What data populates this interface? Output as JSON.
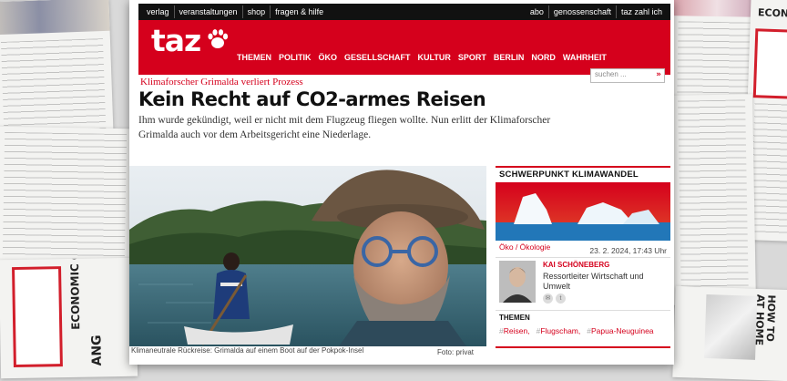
{
  "topbar": {
    "left_links": [
      "verlag",
      "veranstaltungen",
      "shop",
      "fragen & hilfe"
    ],
    "right_links": [
      "abo",
      "genossenschaft",
      "taz zahl ich"
    ]
  },
  "header": {
    "logo_text": "taz",
    "brand_color": "#d5001c",
    "nav": [
      "THEMEN",
      "POLITIK",
      "ÖKO",
      "GESELLSCHAFT",
      "KULTUR",
      "SPORT",
      "BERLIN",
      "NORD",
      "WAHRHEIT"
    ],
    "nav_active": "ÖKO",
    "search_placeholder": "suchen ...",
    "search_icon": "double-chevron-right-icon"
  },
  "article": {
    "kicker": "Klimaforscher Grimalda verliert Prozess",
    "headline": "Kein Recht auf CO2-armes Reisen",
    "teaser": "Ihm wurde gekündigt, weil er nicht mit dem Flugzeug fliegen wollte. Nun erlitt der Klimaforscher Grimalda auch vor dem Arbeitsgericht eine Niederlage.",
    "image_caption": "Klimaneutrale Rückreise: Grimalda auf einem Boot auf der Pokpok-Insel",
    "image_credit": "Foto: privat"
  },
  "sidebar": {
    "focus_title": "SCHWERPUNKT KLIMAWANDEL",
    "category": "Öko / Ökologie",
    "date": "23. 2. 2024, 17:43 Uhr",
    "author_name": "KAI SCHÖNEBERG",
    "author_role": "Ressortleiter Wirtschaft und Umwelt",
    "share_icons": [
      "mail-icon",
      "twitter-icon"
    ],
    "themen_label": "THEMEN",
    "tags": [
      "Reisen",
      "Flugscham",
      "Papua-Neuguinea"
    ]
  },
  "background": {
    "economic_left": "ECONOMIC COLLAP",
    "economic_right": "ECONO",
    "how_to": "HOW TO",
    "at_home": "AT HOME",
    "ang": "ANG"
  }
}
